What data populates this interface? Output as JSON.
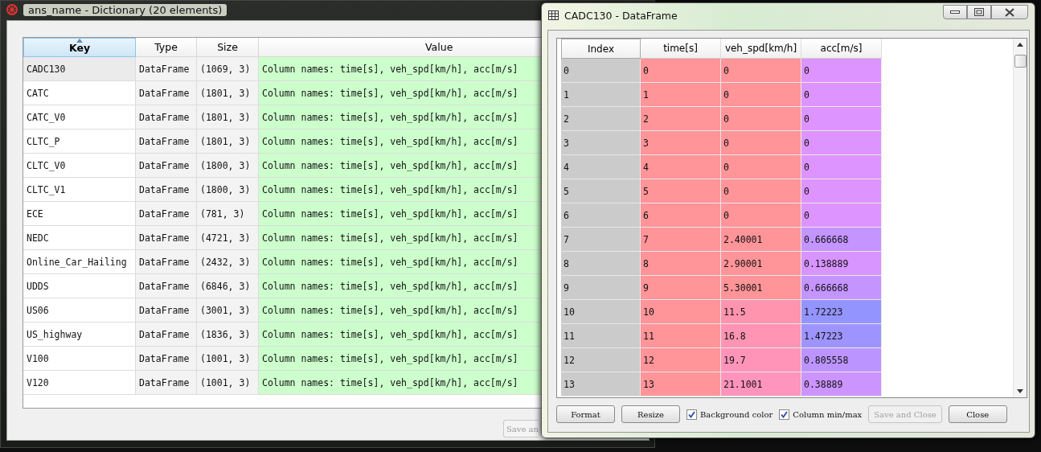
{
  "dictionary_window": {
    "title": "ans_name - Dictionary (20 elements)",
    "columns": [
      {
        "label": "Key",
        "sorted": true
      },
      {
        "label": "Type",
        "sorted": false
      },
      {
        "label": "Size",
        "sorted": false
      },
      {
        "label": "Value",
        "sorted": false
      }
    ],
    "rows": [
      {
        "key": "CADC130",
        "type": "DataFrame",
        "size": "(1069, 3)",
        "value": "Column names: time[s], veh_spd[km/h], acc[m/s]",
        "selected": true
      },
      {
        "key": "CATC",
        "type": "DataFrame",
        "size": "(1801, 3)",
        "value": "Column names: time[s], veh_spd[km/h], acc[m/s]",
        "selected": false
      },
      {
        "key": "CATC_V0",
        "type": "DataFrame",
        "size": "(1801, 3)",
        "value": "Column names: time[s], veh_spd[km/h], acc[m/s]",
        "selected": false
      },
      {
        "key": "CLTC_P",
        "type": "DataFrame",
        "size": "(1801, 3)",
        "value": "Column names: time[s], veh_spd[km/h], acc[m/s]",
        "selected": false
      },
      {
        "key": "CLTC_V0",
        "type": "DataFrame",
        "size": "(1800, 3)",
        "value": "Column names: time[s], veh_spd[km/h], acc[m/s]",
        "selected": false
      },
      {
        "key": "CLTC_V1",
        "type": "DataFrame",
        "size": "(1800, 3)",
        "value": "Column names: time[s], veh_spd[km/h], acc[m/s]",
        "selected": false
      },
      {
        "key": "ECE",
        "type": "DataFrame",
        "size": "(781, 3)",
        "value": "Column names: time[s], veh_spd[km/h], acc[m/s]",
        "selected": false
      },
      {
        "key": "NEDC",
        "type": "DataFrame",
        "size": "(4721, 3)",
        "value": "Column names: time[s], veh_spd[km/h], acc[m/s]",
        "selected": false
      },
      {
        "key": "Online_Car_Hailing",
        "type": "DataFrame",
        "size": "(2432, 3)",
        "value": "Column names: time[s], veh_spd[km/h], acc[m/s]",
        "selected": false
      },
      {
        "key": "UDDS",
        "type": "DataFrame",
        "size": "(6846, 3)",
        "value": "Column names: time[s], veh_spd[km/h], acc[m/s]",
        "selected": false
      },
      {
        "key": "US06",
        "type": "DataFrame",
        "size": "(3001, 3)",
        "value": "Column names: time[s], veh_spd[km/h], acc[m/s]",
        "selected": false
      },
      {
        "key": "US_highway",
        "type": "DataFrame",
        "size": "(1836, 3)",
        "value": "Column names: time[s], veh_spd[km/h], acc[m/s]",
        "selected": false
      },
      {
        "key": "V100",
        "type": "DataFrame",
        "size": "(1001, 3)",
        "value": "Column names: time[s], veh_spd[km/h], acc[m/s]",
        "selected": false
      },
      {
        "key": "V120",
        "type": "DataFrame",
        "size": "(1001, 3)",
        "value": "Column names: time[s], veh_spd[km/h], acc[m/s]",
        "selected": false
      }
    ],
    "buttons": [
      {
        "label": "Save an",
        "disabled": true
      }
    ]
  },
  "dataframe_window": {
    "title": "CADC130 - DataFrame",
    "columns": [
      "Index",
      "time[s]",
      "veh_spd[km/h]",
      "acc[m/s]"
    ],
    "rows": [
      {
        "cells": [
          {
            "text": "0"
          },
          {
            "text": "0",
            "color": "#ff9499"
          },
          {
            "text": "0",
            "color": "#ff9499"
          },
          {
            "text": "0",
            "color": "#dd94ff"
          }
        ]
      },
      {
        "cells": [
          {
            "text": "1"
          },
          {
            "text": "1",
            "color": "#ff9499"
          },
          {
            "text": "0",
            "color": "#ff9499"
          },
          {
            "text": "0",
            "color": "#dd94ff"
          }
        ]
      },
      {
        "cells": [
          {
            "text": "2"
          },
          {
            "text": "2",
            "color": "#ff9499"
          },
          {
            "text": "0",
            "color": "#ff9499"
          },
          {
            "text": "0",
            "color": "#dd94ff"
          }
        ]
      },
      {
        "cells": [
          {
            "text": "3"
          },
          {
            "text": "3",
            "color": "#ff9499"
          },
          {
            "text": "0",
            "color": "#ff9499"
          },
          {
            "text": "0",
            "color": "#dd94ff"
          }
        ]
      },
      {
        "cells": [
          {
            "text": "4"
          },
          {
            "text": "4",
            "color": "#ff9499"
          },
          {
            "text": "0",
            "color": "#ff9499"
          },
          {
            "text": "0",
            "color": "#dd94ff"
          }
        ]
      },
      {
        "cells": [
          {
            "text": "5"
          },
          {
            "text": "5",
            "color": "#ff9499"
          },
          {
            "text": "0",
            "color": "#ff9499"
          },
          {
            "text": "0",
            "color": "#dd94ff"
          }
        ]
      },
      {
        "cells": [
          {
            "text": "6"
          },
          {
            "text": "6",
            "color": "#ff9499"
          },
          {
            "text": "0",
            "color": "#ff9499"
          },
          {
            "text": "0",
            "color": "#dd94ff"
          }
        ]
      },
      {
        "cells": [
          {
            "text": "7"
          },
          {
            "text": "7",
            "color": "#ff9499"
          },
          {
            "text": "2.40001",
            "color": "#ff9499"
          },
          {
            "text": "0.666668",
            "color": "#c494ff"
          }
        ]
      },
      {
        "cells": [
          {
            "text": "8"
          },
          {
            "text": "8",
            "color": "#ff9499"
          },
          {
            "text": "2.90001",
            "color": "#ff9499"
          },
          {
            "text": "0.138889",
            "color": "#d894ff"
          }
        ]
      },
      {
        "cells": [
          {
            "text": "9"
          },
          {
            "text": "9",
            "color": "#ff9499"
          },
          {
            "text": "5.30001",
            "color": "#ff9499"
          },
          {
            "text": "0.666668",
            "color": "#c494ff"
          }
        ]
      },
      {
        "cells": [
          {
            "text": "10"
          },
          {
            "text": "10",
            "color": "#ff9499"
          },
          {
            "text": "11.5",
            "color": "#ff94ae"
          },
          {
            "text": "1.72223",
            "color": "#9494ff"
          }
        ]
      },
      {
        "cells": [
          {
            "text": "11"
          },
          {
            "text": "11",
            "color": "#ff9499"
          },
          {
            "text": "16.8",
            "color": "#ff94b4"
          },
          {
            "text": "1.47223",
            "color": "#9e94ff"
          }
        ]
      },
      {
        "cells": [
          {
            "text": "12"
          },
          {
            "text": "12",
            "color": "#ff9499"
          },
          {
            "text": "19.7",
            "color": "#ff94b8"
          },
          {
            "text": "0.805558",
            "color": "#bc94ff"
          }
        ]
      },
      {
        "cells": [
          {
            "text": "13"
          },
          {
            "text": "13",
            "color": "#ff9499"
          },
          {
            "text": "21.1001",
            "color": "#ff94bc"
          },
          {
            "text": "0.38889",
            "color": "#cc94ff"
          }
        ]
      }
    ],
    "controls": [
      {
        "kind": "button",
        "label": "Format",
        "disabled": false
      },
      {
        "kind": "button",
        "label": "Resize",
        "disabled": false
      },
      {
        "kind": "checkbox",
        "label": "Background color",
        "checked": true
      },
      {
        "kind": "checkbox",
        "label": "Column min/max",
        "checked": true
      },
      {
        "kind": "button",
        "label": "Save and Close",
        "disabled": true
      },
      {
        "kind": "button",
        "label": "Close",
        "disabled": false
      }
    ]
  }
}
